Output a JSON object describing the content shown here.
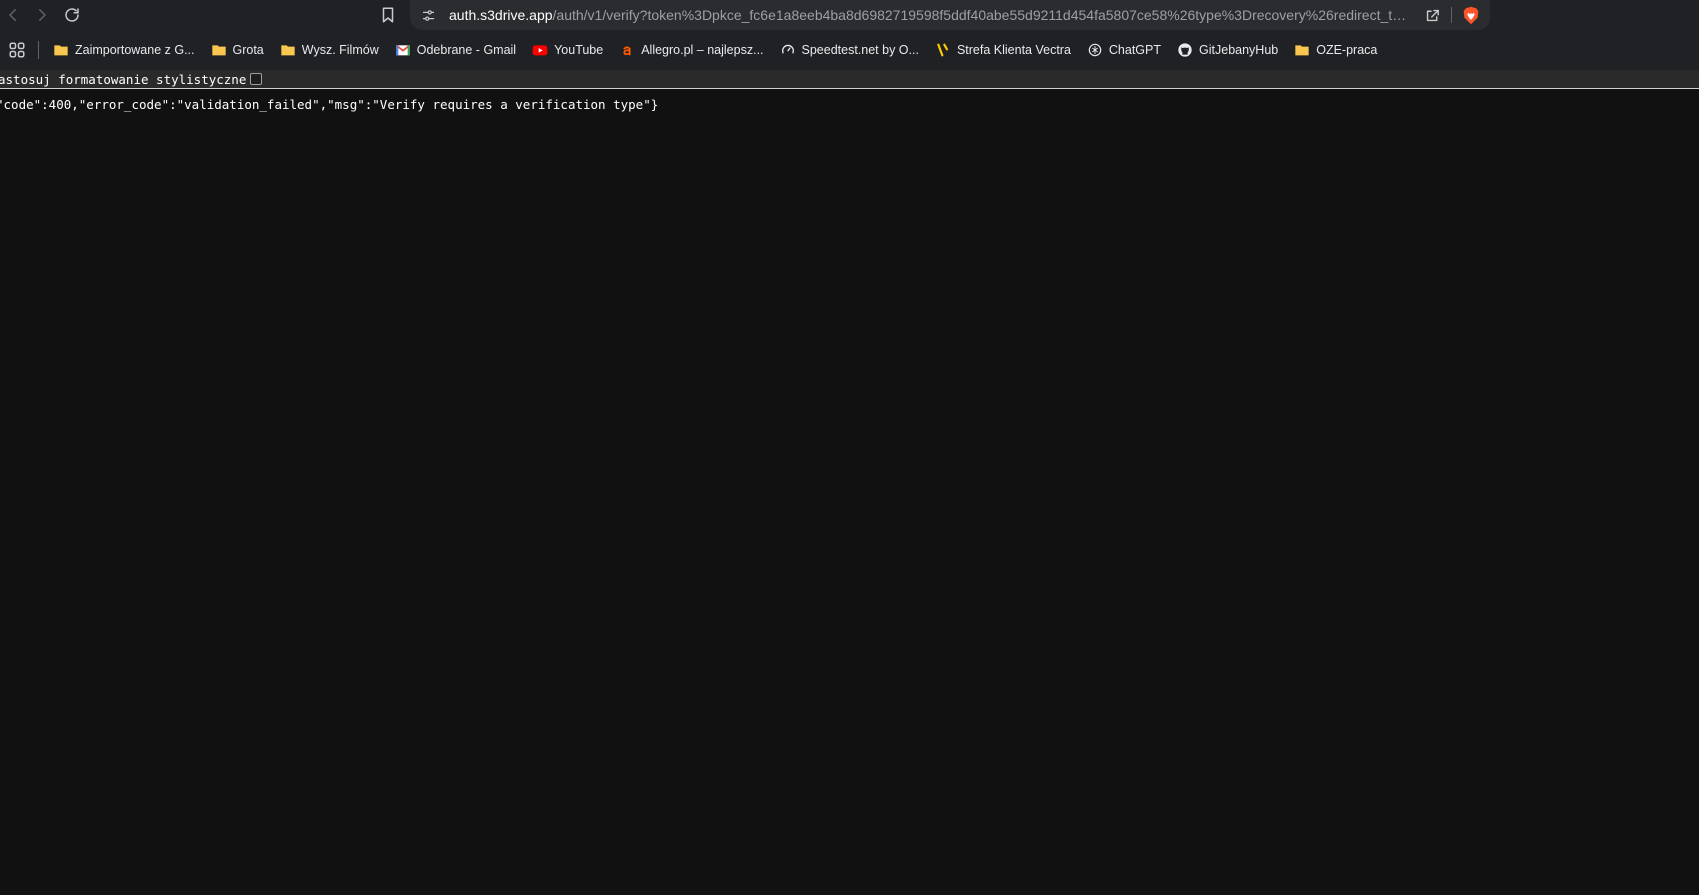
{
  "browser": {
    "url_host": "auth.s3drive.app",
    "url_rest": "/auth/v1/verify?token%3Dpkce_fc6e1a8eeb4ba8d6982719598f5ddf40abe55d9211d454fa5807ce58%26type%3Drecovery%26redirect_to%..."
  },
  "bookmarks": [
    {
      "label": "Zaimportowane z G...",
      "icon": "folder-icon"
    },
    {
      "label": "Grota",
      "icon": "folder-icon"
    },
    {
      "label": "Wysz. Filmów",
      "icon": "folder-icon"
    },
    {
      "label": "Odebrane - Gmail",
      "icon": "gmail-icon"
    },
    {
      "label": "YouTube",
      "icon": "youtube-icon"
    },
    {
      "label": "Allegro.pl – najlepsz...",
      "icon": "allegro-icon"
    },
    {
      "label": "Speedtest.net by O...",
      "icon": "speedtest-icon"
    },
    {
      "label": "Strefa Klienta Vectra",
      "icon": "vectra-icon"
    },
    {
      "label": "ChatGPT",
      "icon": "chatgpt-icon"
    },
    {
      "label": "GitJebanyHub",
      "icon": "github-icon"
    },
    {
      "label": "OZE-praca",
      "icon": "folder-icon"
    }
  ],
  "viewer": {
    "pretty_print_label": "astosuj formatowanie stylistyczne",
    "pretty_print_checked": false
  },
  "content": {
    "json_text": "\"code\":400,\"error_code\":\"validation_failed\",\"msg\":\"Verify requires a verification type\"}"
  },
  "colors": {
    "background": "#111111",
    "chrome": "#202124",
    "omnibox": "#2b2c2f",
    "folder": "#f9c74f",
    "youtube": "#ff0000",
    "allegro": "#ff5a00",
    "vectra": "#ffcc00",
    "brave": "#fb542b"
  }
}
